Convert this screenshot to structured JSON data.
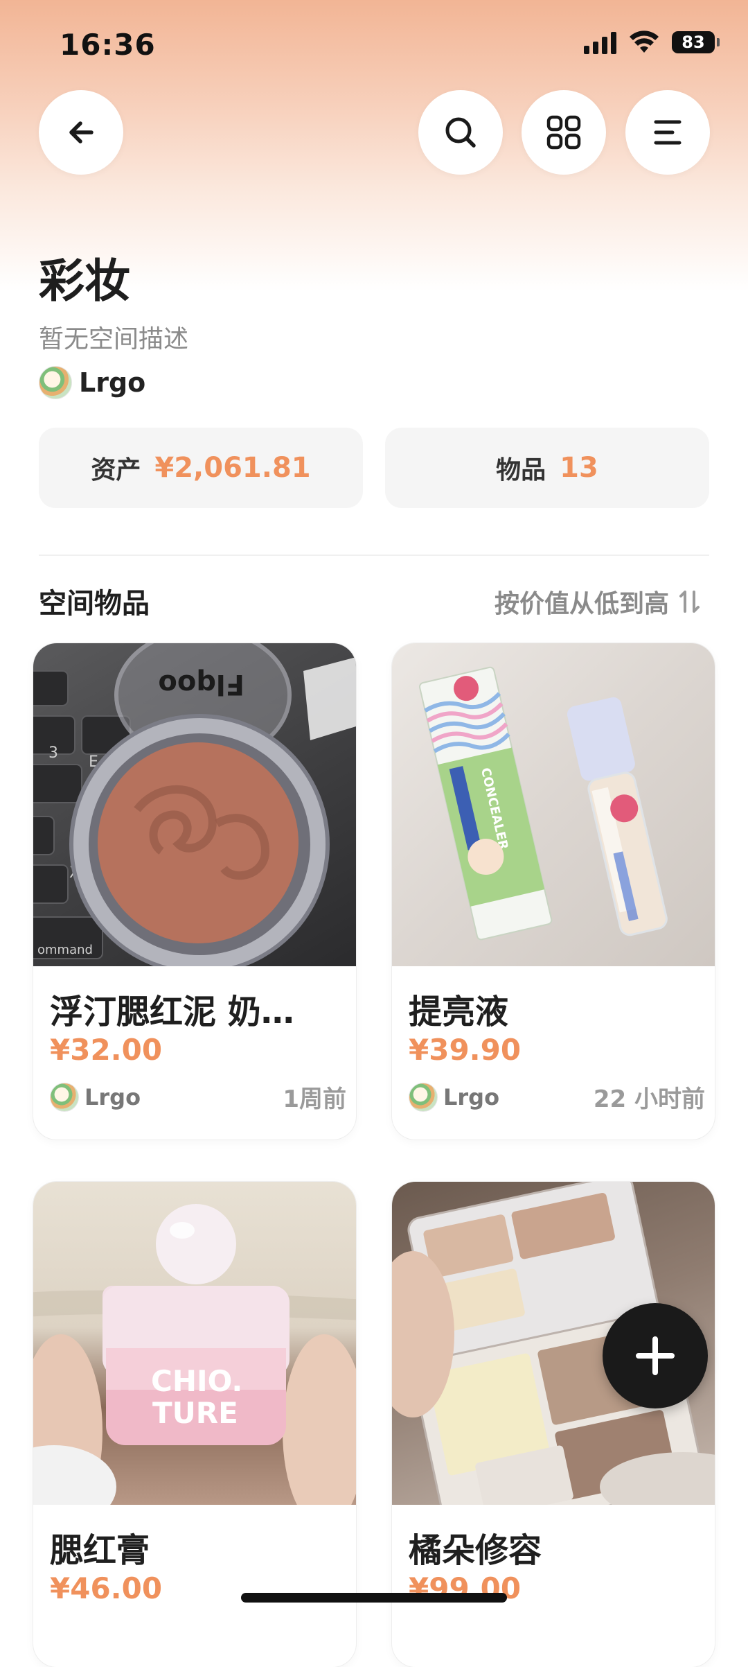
{
  "status_bar": {
    "time": "16:36",
    "battery": "83"
  },
  "header": {
    "back_icon": "back-arrow-icon",
    "search_icon": "search-icon",
    "grid_icon": "grid-icon",
    "menu_icon": "menu-lines-icon"
  },
  "space": {
    "title": "彩妆",
    "description": "暂无空间描述",
    "owner": "Lrgo"
  },
  "stats": {
    "assets_label": "资产",
    "assets_value": "¥2,061.81",
    "items_label": "物品",
    "items_value": "13"
  },
  "section": {
    "title": "空间物品",
    "sort_label": "按价值从低到高",
    "sort_icon": "sort-icon"
  },
  "items": [
    {
      "name": "浮汀腮红泥 奶…",
      "price": "¥32.00",
      "user": "Lrgo",
      "time": "1周前"
    },
    {
      "name": "提亮液",
      "price": "¥39.90",
      "user": "Lrgo",
      "time": "22 小时前"
    },
    {
      "name": "腮红膏",
      "price": "¥46.00",
      "user": "",
      "time": ""
    },
    {
      "name": "橘朵修容",
      "price": "¥99.00",
      "user": "",
      "time": ""
    }
  ],
  "image_text": {
    "blush_brand": "Flqoo",
    "concealer_brand": "CONCEALER",
    "cushion_brand_1": "CHIO.",
    "cushion_brand_2": "TURE"
  },
  "colors": {
    "accent": "#f0915c",
    "fab": "#1a1a1a"
  }
}
